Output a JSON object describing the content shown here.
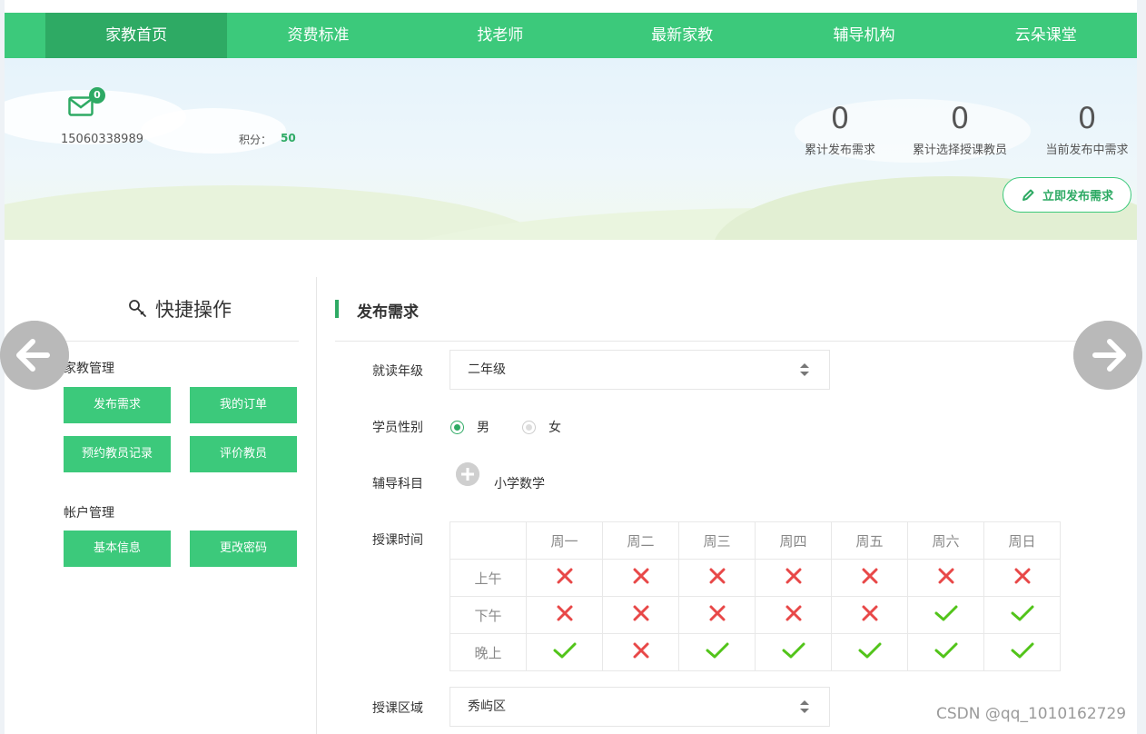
{
  "nav": {
    "items": [
      "家教首页",
      "资费标准",
      "找老师",
      "最新家教",
      "辅导机构",
      "云朵课堂"
    ],
    "active": 0
  },
  "banner": {
    "mail_count": "0",
    "phone": "15060338989",
    "points_label": "积分：",
    "points_value": "50",
    "stats": [
      {
        "value": "0",
        "label": "累计发布需求"
      },
      {
        "value": "0",
        "label": "累计选择授课教员"
      },
      {
        "value": "0",
        "label": "当前发布中需求"
      }
    ],
    "publish_button": "立即发布需求"
  },
  "sidebar": {
    "title": "快捷操作",
    "groups": [
      {
        "title": "家教管理",
        "buttons": [
          "发布需求",
          "我的订单",
          "预约教员记录",
          "评价教员"
        ]
      },
      {
        "title": "帐户管理",
        "buttons": [
          "基本信息",
          "更改密码"
        ]
      }
    ]
  },
  "form": {
    "title": "发布需求",
    "grade_label": "就读年级",
    "grade_value": "二年级",
    "gender_label": "学员性别",
    "gender_options": [
      "男",
      "女"
    ],
    "gender_selected": "男",
    "subject_label": "辅导科目",
    "subject_value": "小学数学",
    "time_label": "授课时间",
    "days": [
      "周一",
      "周二",
      "周三",
      "周四",
      "周五",
      "周六",
      "周日"
    ],
    "periods": [
      "上午",
      "下午",
      "晚上"
    ],
    "availability": [
      [
        false,
        false,
        false,
        false,
        false,
        false,
        false
      ],
      [
        false,
        false,
        false,
        false,
        false,
        true,
        true
      ],
      [
        true,
        false,
        true,
        true,
        true,
        true,
        true
      ]
    ],
    "area_label": "授课区域",
    "area_value": "秀屿区"
  },
  "watermark": "CSDN @qq_1010162729",
  "colors": {
    "primary": "#3cc97b",
    "primary_dark": "#2eaa64",
    "cross": "#e84848",
    "check": "#52c41a"
  }
}
